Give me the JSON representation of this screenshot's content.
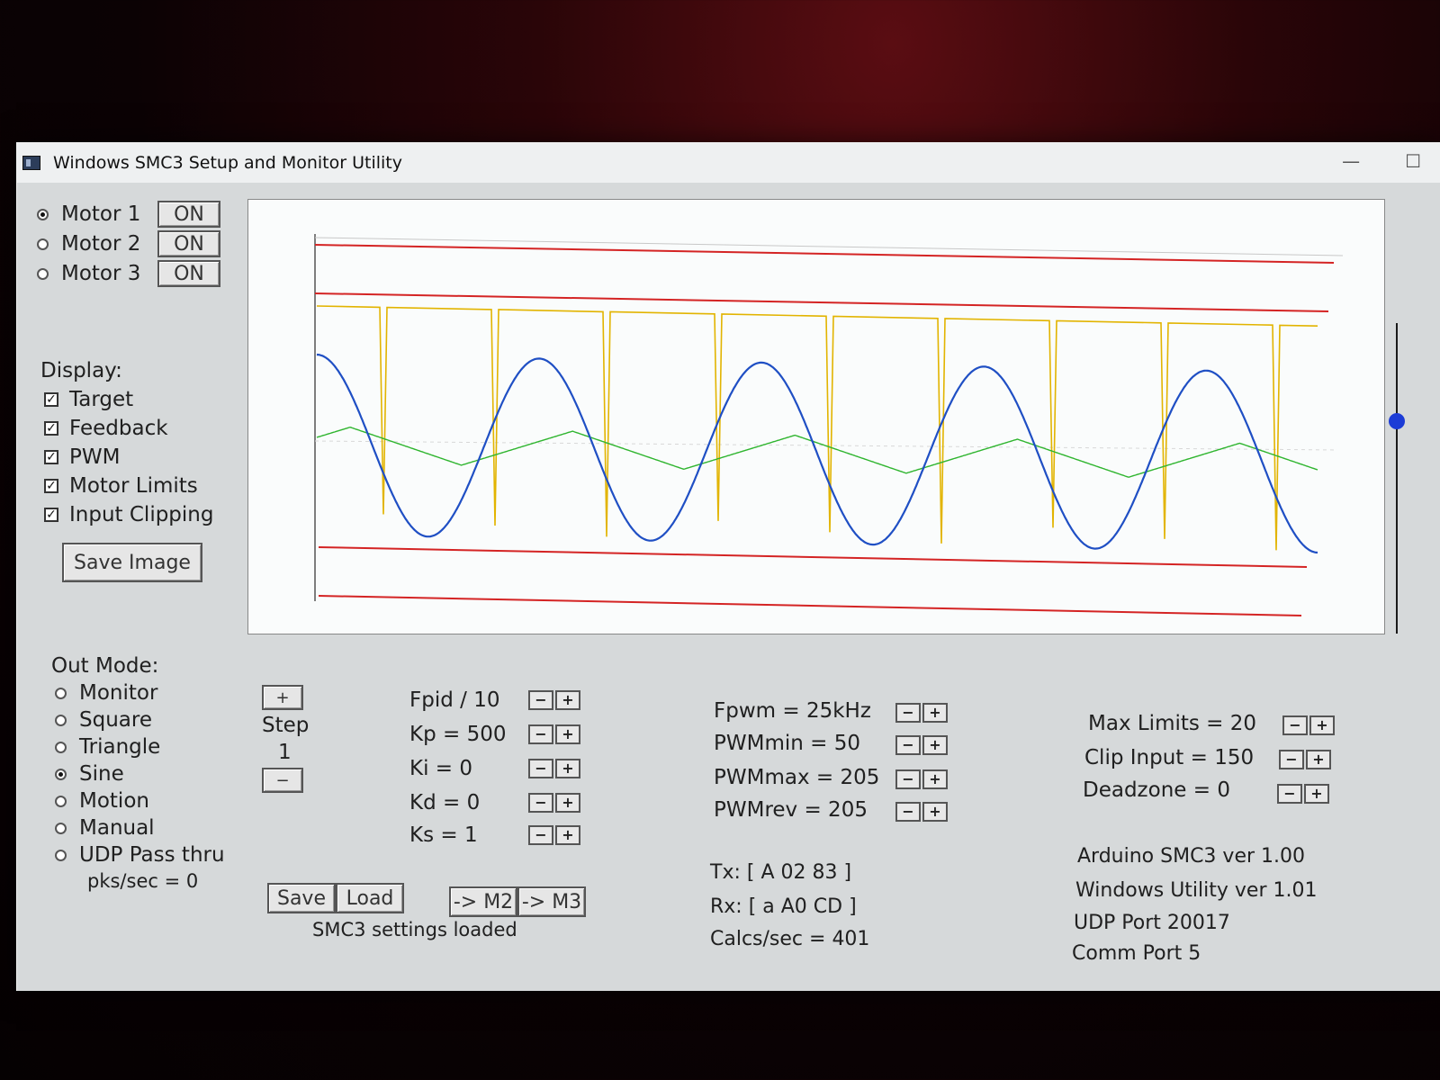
{
  "window": {
    "title": "Windows SMC3 Setup and Monitor Utility",
    "minimize_glyph": "—",
    "maximize_glyph": "☐"
  },
  "motors": [
    {
      "label": "Motor 1",
      "selected": true,
      "state": "ON"
    },
    {
      "label": "Motor 2",
      "selected": false,
      "state": "ON"
    },
    {
      "label": "Motor 3",
      "selected": false,
      "state": "ON"
    }
  ],
  "display": {
    "heading": "Display:",
    "options": [
      {
        "label": "Target",
        "checked": true
      },
      {
        "label": "Feedback",
        "checked": true
      },
      {
        "label": "PWM",
        "checked": true
      },
      {
        "label": "Motor Limits",
        "checked": true
      },
      {
        "label": "Input Clipping",
        "checked": true
      }
    ],
    "save_image": "Save Image"
  },
  "out_mode": {
    "heading": "Out Mode:",
    "options": [
      {
        "label": "Monitor",
        "selected": false
      },
      {
        "label": "Square",
        "selected": false
      },
      {
        "label": "Triangle",
        "selected": false
      },
      {
        "label": "Sine",
        "selected": true
      },
      {
        "label": "Motion",
        "selected": false
      },
      {
        "label": "Manual",
        "selected": false
      },
      {
        "label": "UDP Pass thru",
        "selected": false
      }
    ],
    "pks_per_sec": "pks/sec = 0"
  },
  "step": {
    "plus": "+",
    "label": "Step",
    "value": "1",
    "minus": "−"
  },
  "pid": [
    {
      "label": "Fpid / 10"
    },
    {
      "label": "Kp = 500"
    },
    {
      "label": "Ki = 0"
    },
    {
      "label": "Kd = 0"
    },
    {
      "label": "Ks = 1"
    }
  ],
  "pwm": [
    {
      "label": "Fpwm = 25kHz"
    },
    {
      "label": "PWMmin = 50"
    },
    {
      "label": "PWMmax = 205"
    },
    {
      "label": "PWMrev = 205"
    }
  ],
  "limits": [
    {
      "label": "Max Limits = 20"
    },
    {
      "label": "Clip Input = 150"
    },
    {
      "label": "Deadzone = 0"
    }
  ],
  "pm_glyphs": {
    "minus": "−",
    "plus": "+"
  },
  "settings": {
    "save": "Save",
    "load": "Load",
    "to_m2": "-> M2",
    "to_m3": "-> M3",
    "status": "SMC3 settings loaded"
  },
  "comm": {
    "tx": "Tx: [ A 02 83 ]",
    "rx": "Rx: [ a A0 CD ]",
    "calcs": "Calcs/sec = 401"
  },
  "info": {
    "arduino": "Arduino SMC3 ver 1.00",
    "utility": "Windows Utility ver 1.01",
    "udp_port": "UDP Port 20017",
    "comm_port": "Comm Port 5"
  },
  "plot": {
    "colors": {
      "target": "#1f4fc4",
      "feedback": "#2fb52f",
      "pwm": "#e2b400",
      "limits": "#d42424",
      "clip": "#c8c8c8"
    },
    "sine_cycles": 4.5,
    "sine_amplitude": 0.85,
    "pwm_spikes": 9
  }
}
